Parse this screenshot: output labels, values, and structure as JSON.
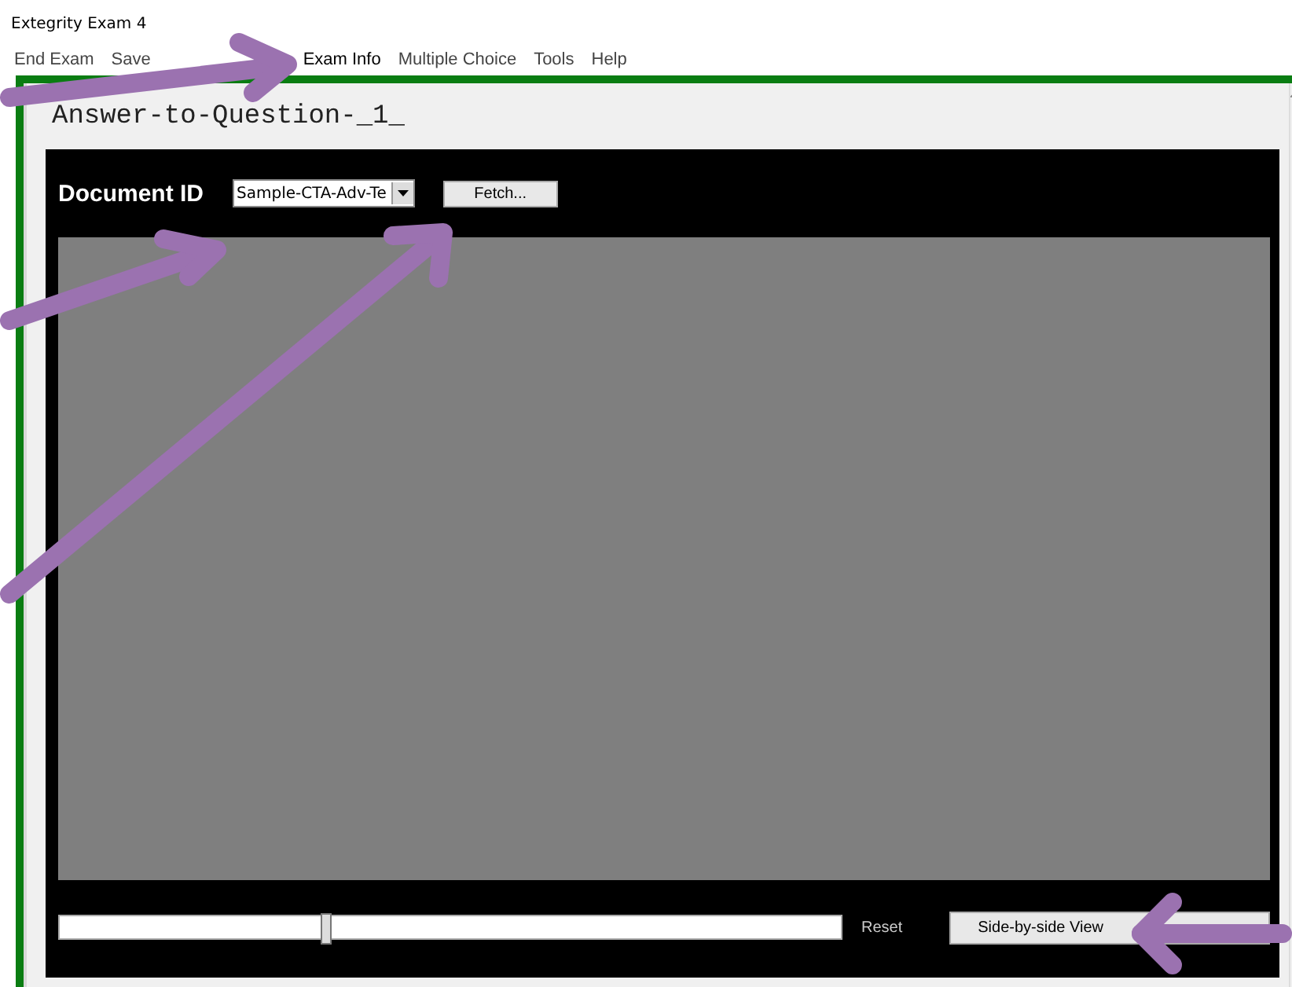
{
  "window": {
    "title": "Extegrity Exam 4"
  },
  "menu": [
    {
      "label": "End Exam"
    },
    {
      "label": "Save"
    },
    {
      "label": "Exam Info"
    },
    {
      "label": "Multiple Choice"
    },
    {
      "label": "Tools"
    },
    {
      "label": "Help"
    }
  ],
  "document": {
    "heading": "Answer-to-Question-_1_"
  },
  "toolbar": {
    "label": "Document ID",
    "document_id": "Sample-CTA-Adv-Te",
    "fetch_button": "Fetch..."
  },
  "footer": {
    "zoom": {
      "level": 0.34
    },
    "reset_label": "Reset",
    "side_by_side_button": "Side-by-side View"
  }
}
